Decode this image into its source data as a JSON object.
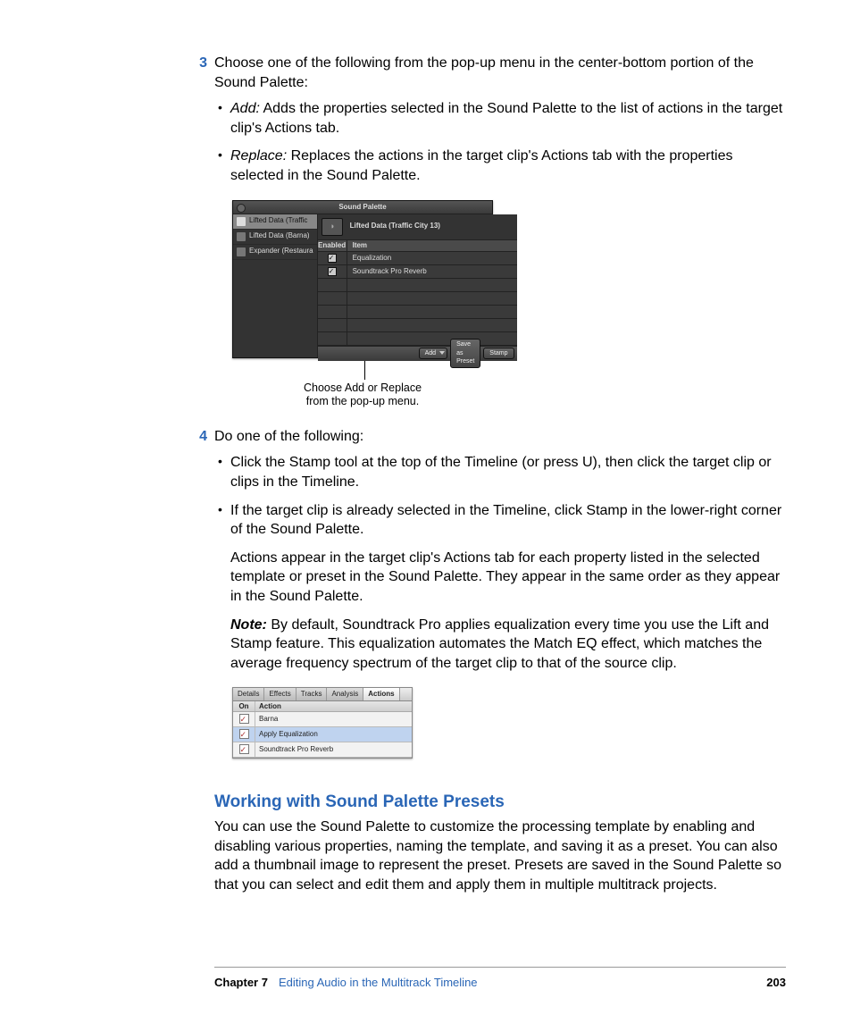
{
  "steps": {
    "s3": {
      "num": "3",
      "intro": "Choose one of the following from the pop-up menu in the center-bottom portion of the Sound Palette:",
      "bullets": [
        {
          "term": "Add:",
          "text": "  Adds the properties selected in the Sound Palette to the list of actions in the target clip's Actions tab."
        },
        {
          "term": "Replace:",
          "text": "  Replaces the actions in the target clip's Actions tab with the properties selected in the Sound Palette."
        }
      ]
    },
    "s4": {
      "num": "4",
      "intro": "Do one of the following:",
      "bullets": [
        {
          "text": "Click the Stamp tool at the top of the Timeline (or press U), then click the target clip or clips in the Timeline."
        },
        {
          "text": "If the target clip is already selected in the Timeline, click Stamp in the lower-right corner of the Sound Palette."
        }
      ],
      "after1": "Actions appear in the target clip's Actions tab for each property listed in the selected template or preset in the Sound Palette. They appear in the same order as they appear in the Sound Palette.",
      "note_label": "Note:",
      "note_text": "  By default, Soundtrack Pro applies equalization every time you use the Lift and Stamp feature. This equalization automates the Match EQ effect, which matches the average frequency spectrum of the target clip to that of the source clip."
    }
  },
  "sound_palette": {
    "title": "Sound Palette",
    "left_items": [
      {
        "label": "Lifted Data (Traffic",
        "selected": true
      },
      {
        "label": "Lifted Data (Barna)",
        "selected": false
      },
      {
        "label": "Expander (Restaura",
        "selected": false
      }
    ],
    "right_title": "Lifted Data (Traffic City 13)",
    "thumb_glyph": "◑",
    "columns": {
      "c1": "Enabled",
      "c2": "Item"
    },
    "rows": [
      {
        "label": "Equalization"
      },
      {
        "label": "Soundtrack Pro Reverb"
      }
    ],
    "footer": {
      "add": "Add",
      "save": "Save as Preset",
      "stamp": "Stamp"
    },
    "callout_l1": "Choose Add or Replace",
    "callout_l2": "from the pop-up menu."
  },
  "actions_panel": {
    "tabs": [
      "Details",
      "Effects",
      "Tracks",
      "Analysis",
      "Actions"
    ],
    "selected_tab": 4,
    "columns": {
      "c1": "On",
      "c2": "Action"
    },
    "rows": [
      {
        "label": "Barna",
        "selected": false
      },
      {
        "label": "Apply Equalization",
        "selected": true
      },
      {
        "label": "Soundtrack Pro Reverb",
        "selected": false
      }
    ]
  },
  "section": {
    "heading": "Working with Sound Palette Presets",
    "body": "You can use the Sound Palette to customize the processing template by enabling and disabling various properties, naming the template, and saving it as a preset. You can also add a thumbnail image to represent the preset. Presets are saved in the Sound Palette so that you can select and edit them and apply them in multiple multitrack projects."
  },
  "footer": {
    "chapter": "Chapter 7",
    "title": "Editing Audio in the Multitrack Timeline",
    "page": "203"
  }
}
